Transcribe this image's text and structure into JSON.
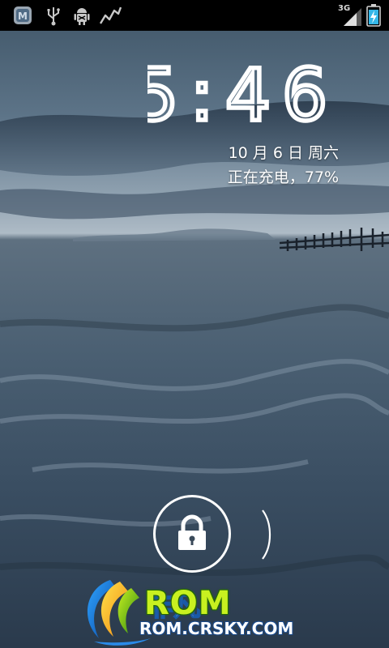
{
  "status_bar": {
    "network_type": "3G",
    "icons": [
      "maxthon-notification-icon",
      "usb-icon",
      "android-debug-icon",
      "activity-graph-icon",
      "signal-icon",
      "battery-charging-icon"
    ]
  },
  "lockscreen": {
    "time": "5:46",
    "date": "10 月 6 日 周六",
    "charging_status": "正在充电，77%"
  },
  "watermark": {
    "brand": "ROM",
    "url": "ROM.CRSKY.COM",
    "brand_color": "#c8f020"
  }
}
